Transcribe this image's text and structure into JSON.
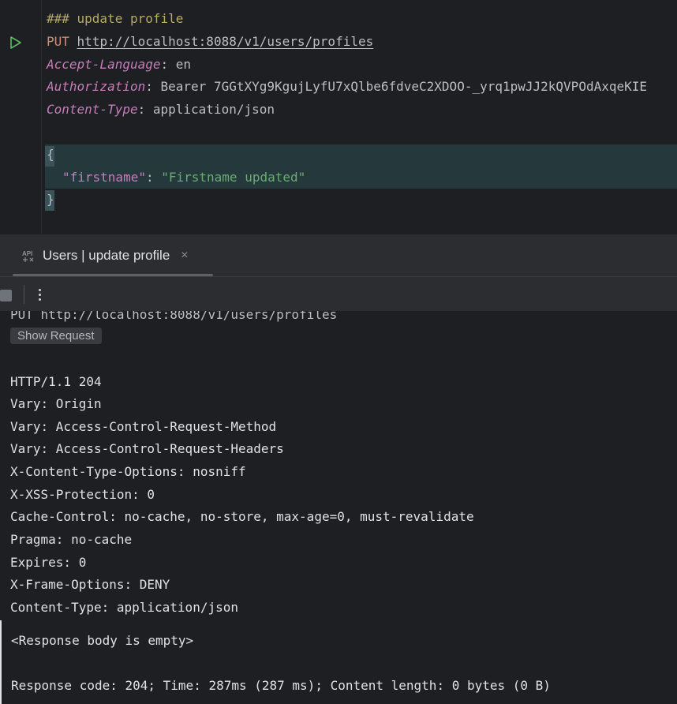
{
  "editor": {
    "comment": "### update profile",
    "method": "PUT",
    "url": "http://localhost:8088/v1/users/profiles",
    "headers": [
      {
        "name": "Accept-Language",
        "value": " en"
      },
      {
        "name": "Authorization",
        "value": " Bearer 7GGtXYg9KgujLyfU7xQlbe6fdveC2XDOO-_yrq1pwJJ2kQVPOdAxqeKIE"
      },
      {
        "name": "Content-Type",
        "value": " application/json"
      }
    ],
    "body": {
      "open": "{",
      "key": "\"firstname\"",
      "colon": ": ",
      "value": "\"Firstname updated\"",
      "close": "}"
    }
  },
  "tool_window": {
    "tab_label": "Users | update profile",
    "tab_close": "×",
    "tab_icon": "api-icon"
  },
  "console": {
    "request_line": "PUT http://localhost:8088/v1/users/profiles",
    "show_request_label": "Show Request",
    "response_lines": [
      "HTTP/1.1 204",
      "Vary: Origin",
      "Vary: Access-Control-Request-Method",
      "Vary: Access-Control-Request-Headers",
      "X-Content-Type-Options: nosniff",
      "X-XSS-Protection: 0",
      "Cache-Control: no-cache, no-store, max-age=0, must-revalidate",
      "Pragma: no-cache",
      "Expires: 0",
      "X-Frame-Options: DENY",
      "Content-Type: application/json"
    ],
    "empty_body": "<Response body is empty>",
    "summary": "Response code: 204; Time: 287ms (287 ms); Content length: 0 bytes (0 B)"
  }
}
